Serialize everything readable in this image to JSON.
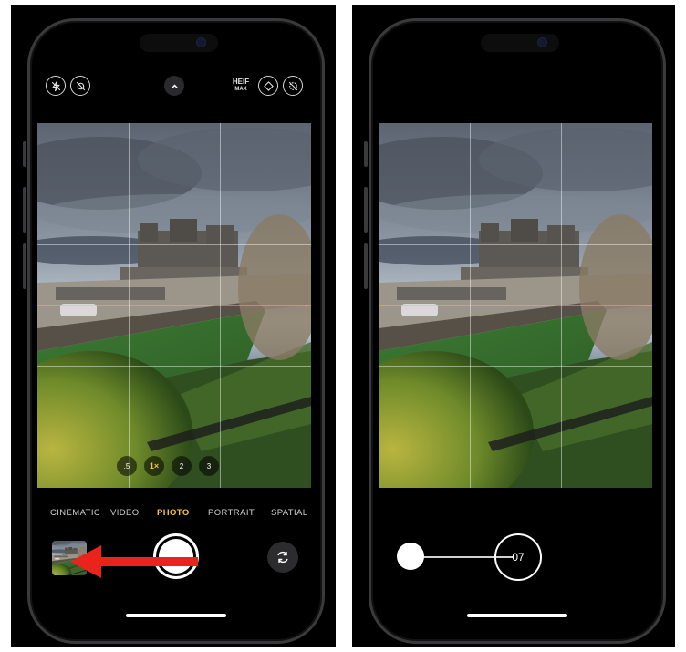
{
  "left_screen": {
    "format_badge": {
      "line1": "HEIF",
      "line2": "MAX"
    },
    "top_icons": [
      "flash-off-icon",
      "live-photo-off-icon",
      "chevron-up-icon",
      "styles-icon",
      "live-off-icon"
    ],
    "zoom_levels": [
      ".5",
      "1×",
      "2",
      "3"
    ],
    "active_zoom": "1×",
    "modes": [
      "CINEMATIC",
      "VIDEO",
      "PHOTO",
      "PORTRAIT",
      "SPATIAL"
    ],
    "active_mode": "PHOTO",
    "annotation_arrow_color": "#e8241d"
  },
  "right_screen": {
    "timer_value": "07"
  },
  "colors": {
    "accent_yellow": "#f4c542",
    "background": "#000000"
  }
}
